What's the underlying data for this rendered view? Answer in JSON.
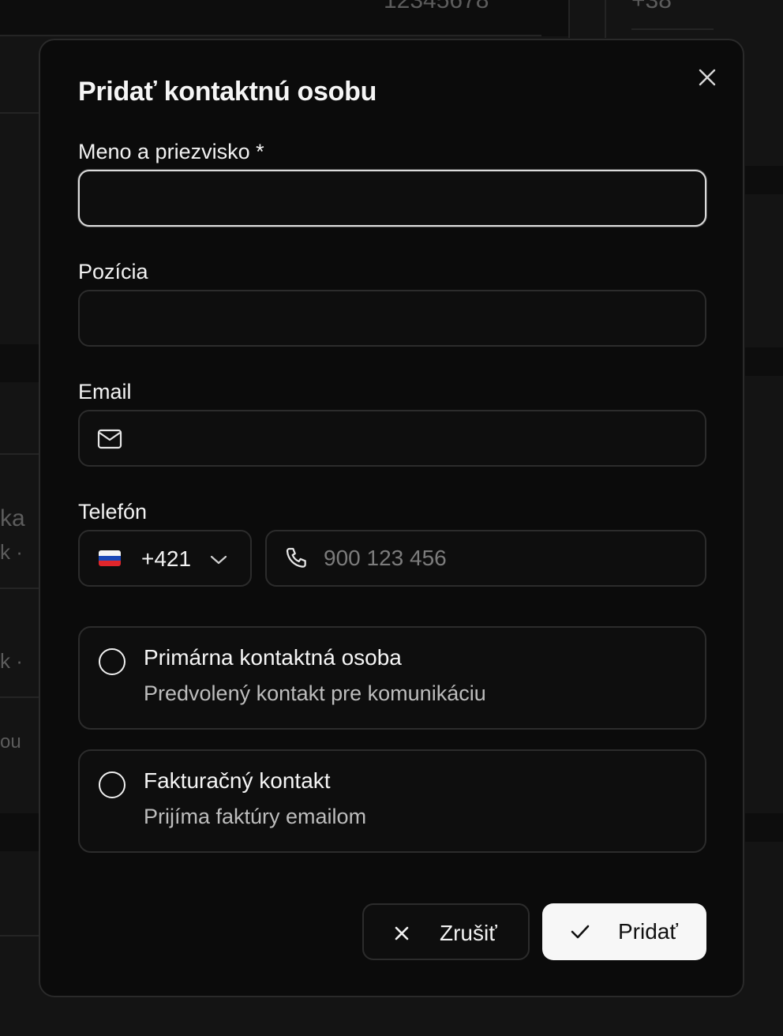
{
  "background": {
    "fragments": [
      "ka",
      "k ·",
      "k ·",
      "ou",
      "12345678",
      "+38"
    ]
  },
  "modal": {
    "title": "Pridať kontaktnú osobu",
    "close_icon": "close-icon",
    "fields": {
      "name": {
        "label": "Meno a priezvisko *",
        "value": "",
        "placeholder": ""
      },
      "position": {
        "label": "Pozícia",
        "value": "",
        "placeholder": ""
      },
      "email": {
        "label": "Email",
        "value": "",
        "placeholder": "",
        "icon": "mail-icon"
      },
      "phone": {
        "label": "Telefón",
        "country_flag": "slovakia-flag",
        "dial_code": "+421",
        "value": "",
        "placeholder": "900 123 456",
        "icon": "phone-icon"
      }
    },
    "options": [
      {
        "title": "Primárna kontaktná osoba",
        "description": "Predvolený kontakt pre komunikáciu",
        "checked": false
      },
      {
        "title": "Fakturačný kontakt",
        "description": "Prijíma faktúry emailom",
        "checked": false
      }
    ],
    "buttons": {
      "cancel_label": "Zrušiť",
      "add_label": "Pridať"
    }
  },
  "colors": {
    "background": "#121212",
    "modal_bg": "#0b0b0b",
    "border": "#2c2c2c",
    "primary_button_bg": "#f7f7f7",
    "text": "#f2f2f2",
    "muted_text": "#bdbdbd"
  }
}
